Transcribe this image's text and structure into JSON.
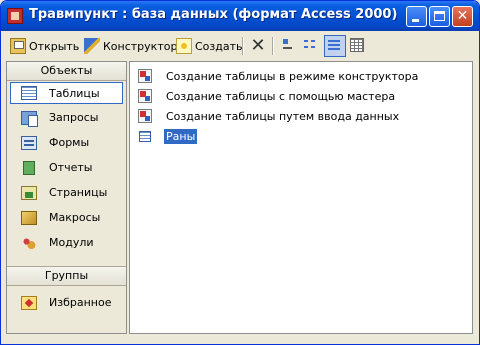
{
  "window": {
    "title": "Травмпункт : база данных (формат Access 2000)",
    "close_glyph": "✕"
  },
  "toolbar": {
    "open_label": "Открыть",
    "design_label": "Конструктор",
    "create_label": "Создать",
    "delete_glyph": "✕",
    "view_mode_active": "details"
  },
  "sidebar": {
    "objects_header": "Объекты",
    "items": [
      {
        "label": "Таблицы",
        "icon": "tables-icon",
        "selected": true
      },
      {
        "label": "Запросы",
        "icon": "queries-icon"
      },
      {
        "label": "Формы",
        "icon": "forms-icon"
      },
      {
        "label": "Отчеты",
        "icon": "reports-icon"
      },
      {
        "label": "Страницы",
        "icon": "pages-icon"
      },
      {
        "label": "Макросы",
        "icon": "macros-icon"
      },
      {
        "label": "Модули",
        "icon": "modules-icon"
      }
    ],
    "groups_header": "Группы",
    "favorites_label": "Избранное"
  },
  "list": {
    "items": [
      {
        "label": "Создание таблицы в режиме конструктора",
        "icon": "wizard-icon"
      },
      {
        "label": "Создание таблицы с помощью мастера",
        "icon": "wizard-icon"
      },
      {
        "label": "Создание таблицы путем ввода данных",
        "icon": "wizard-icon"
      },
      {
        "label": "Раны",
        "icon": "table-icon",
        "selected": true
      }
    ]
  },
  "colors": {
    "titlebar": "#0451D5",
    "selection": "#316AC5",
    "face": "#ECE9D8"
  }
}
